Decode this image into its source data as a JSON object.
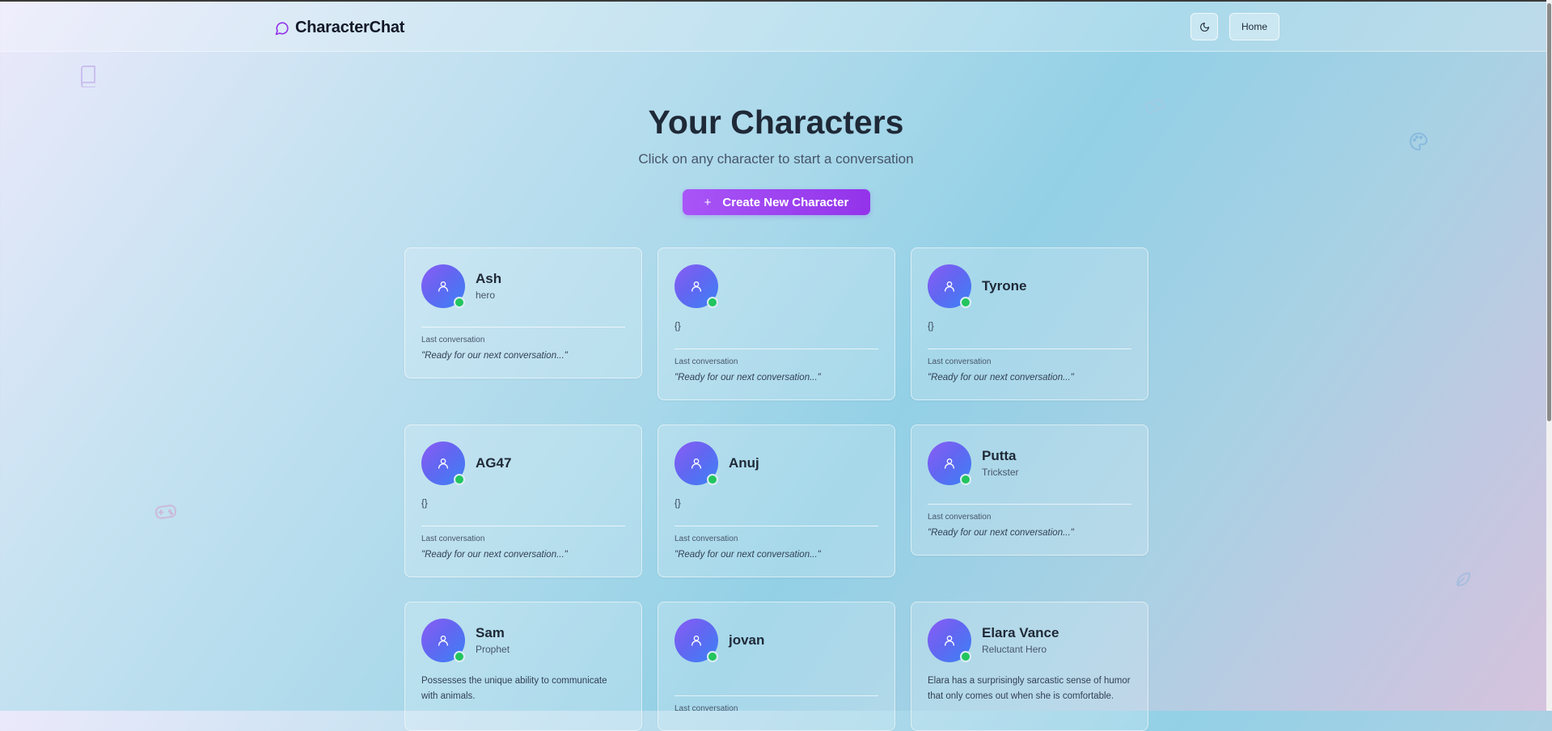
{
  "app": {
    "brand_name": "CharacterChat",
    "home_label": "Home"
  },
  "page": {
    "title": "Your Characters",
    "subtitle": "Click on any character to start a conversation",
    "create_button_label": "Create New Character"
  },
  "cards": [
    {
      "name": "Ash",
      "role": "hero",
      "description": "",
      "last_label": "Last conversation",
      "last_text": "\"Ready for our next conversation...\""
    },
    {
      "name": "",
      "role": "",
      "description": "{}",
      "last_label": "Last conversation",
      "last_text": "\"Ready for our next conversation...\""
    },
    {
      "name": "Tyrone",
      "role": "",
      "description": "{}",
      "last_label": "Last conversation",
      "last_text": "\"Ready for our next conversation...\""
    },
    {
      "name": "AG47",
      "role": "",
      "description": "{}",
      "last_label": "Last conversation",
      "last_text": "\"Ready for our next conversation...\""
    },
    {
      "name": "Anuj",
      "role": "",
      "description": "{}",
      "last_label": "Last conversation",
      "last_text": "\"Ready for our next conversation...\""
    },
    {
      "name": "Putta",
      "role": "Trickster",
      "description": "",
      "last_label": "Last conversation",
      "last_text": "\"Ready for our next conversation...\""
    },
    {
      "name": "Sam",
      "role": "Prophet",
      "description": "Possesses the unique ability to communicate with animals.",
      "last_label": "",
      "last_text": ""
    },
    {
      "name": "jovan",
      "role": "",
      "description": "",
      "last_label": "Last conversation",
      "last_text": ""
    },
    {
      "name": "Elara Vance",
      "role": "Reluctant Hero",
      "description": "Elara has a surprisingly sarcastic sense of humor that only comes out when she is comfortable.",
      "last_label": "",
      "last_text": ""
    }
  ],
  "icons": {
    "brand": "message-circle-icon",
    "theme": "moon-icon",
    "avatar": "user-icon",
    "decor": [
      "book-icon",
      "gamepad-icon",
      "palette-icon",
      "brush-icon",
      "leaf-icon"
    ]
  },
  "colors": {
    "accent": "#9333ea",
    "online": "#22c55e",
    "avatar_from": "#8b5cf6",
    "avatar_to": "#3b82f6"
  }
}
